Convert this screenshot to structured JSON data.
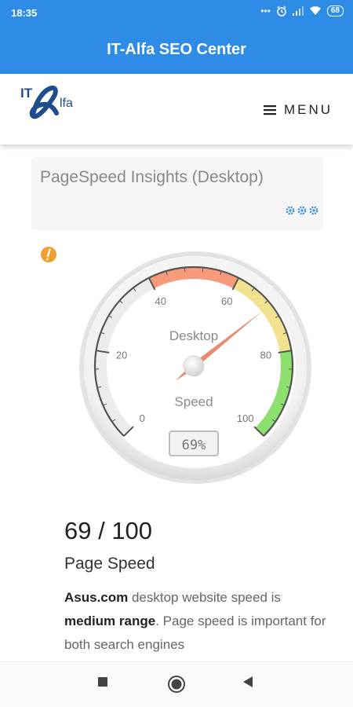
{
  "status_bar": {
    "time": "18:35",
    "dots": "•••",
    "battery": "68"
  },
  "app_bar": {
    "title": "IT-Alfa SEO Center"
  },
  "header": {
    "logo_text": "IT Alfa",
    "menu_label": "MENU"
  },
  "card": {
    "title": "PageSpeed Insights (Desktop)"
  },
  "gauge": {
    "label_top": "Desktop",
    "label_bottom": "Speed",
    "readout": "69%",
    "value": 69,
    "min": 0,
    "max": 100,
    "tick_labels": [
      "0",
      "20",
      "40",
      "60",
      "80",
      "100"
    ],
    "zone_colors": {
      "red": "#f89a7c",
      "yellow": "#f1e28f",
      "green": "#8ce06d"
    }
  },
  "result": {
    "score": "69 / 100",
    "subtitle": "Page Speed",
    "site": "Asus.com",
    "text1": " desktop website speed is ",
    "range": "medium range",
    "text2": ". Page speed is important for both search engines"
  },
  "colors": {
    "primary": "#2e8be6",
    "warning": "#f0a030"
  }
}
